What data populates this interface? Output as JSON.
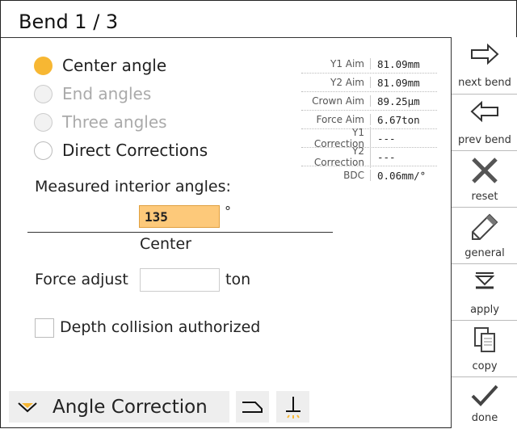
{
  "header": {
    "title": "Bend 1 / 3"
  },
  "options": [
    {
      "label": "Center angle",
      "state": "selected"
    },
    {
      "label": "End angles",
      "state": "disabled"
    },
    {
      "label": "Three angles",
      "state": "disabled"
    },
    {
      "label": "Direct Corrections",
      "state": "enabled"
    }
  ],
  "info": [
    {
      "key": "Y1 Aim",
      "value": "81.09mm"
    },
    {
      "key": "Y2 Aim",
      "value": "81.09mm"
    },
    {
      "key": "Crown Aim",
      "value": "89.25µm"
    },
    {
      "key": "Force Aim",
      "value": "6.67ton"
    },
    {
      "key": "Y1 Correction",
      "value": "---"
    },
    {
      "key": "Y2 Correction",
      "value": "---"
    },
    {
      "key": "BDC",
      "value": "0.06mm/°"
    }
  ],
  "measure": {
    "title": "Measured interior angles:",
    "value": "135",
    "unit": "°",
    "position_label": "Center"
  },
  "force": {
    "label": "Force adjust",
    "value": "",
    "unit": "ton"
  },
  "depth": {
    "label": "Depth collision authorized",
    "checked": false
  },
  "bottom": {
    "mode_label": "Angle Correction"
  },
  "sidebar": {
    "next": "next bend",
    "prev": "prev bend",
    "reset": "reset",
    "general": "general",
    "apply": "apply",
    "copy": "copy",
    "done": "done"
  },
  "colors": {
    "accent": "#f7b733",
    "input_highlight": "#fdc97a"
  }
}
